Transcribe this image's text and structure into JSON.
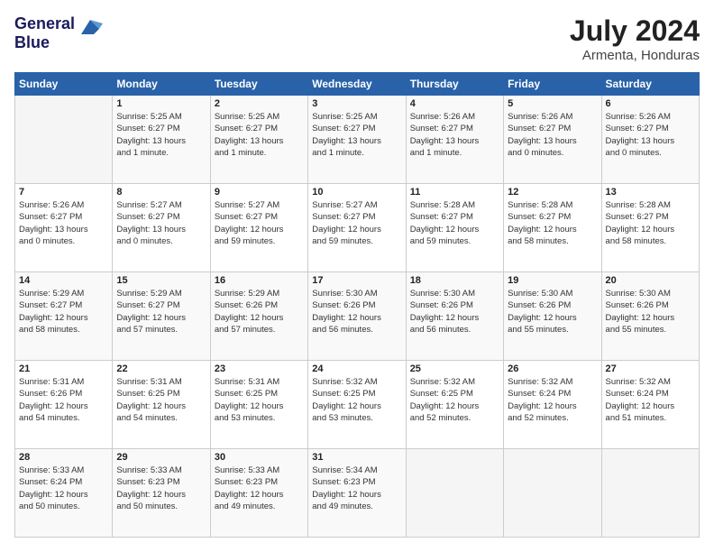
{
  "header": {
    "logo_line1": "General",
    "logo_line2": "Blue",
    "month_year": "July 2024",
    "location": "Armenta, Honduras"
  },
  "weekdays": [
    "Sunday",
    "Monday",
    "Tuesday",
    "Wednesday",
    "Thursday",
    "Friday",
    "Saturday"
  ],
  "weeks": [
    [
      {
        "day": "",
        "details": ""
      },
      {
        "day": "1",
        "details": "Sunrise: 5:25 AM\nSunset: 6:27 PM\nDaylight: 13 hours\nand 1 minute."
      },
      {
        "day": "2",
        "details": "Sunrise: 5:25 AM\nSunset: 6:27 PM\nDaylight: 13 hours\nand 1 minute."
      },
      {
        "day": "3",
        "details": "Sunrise: 5:25 AM\nSunset: 6:27 PM\nDaylight: 13 hours\nand 1 minute."
      },
      {
        "day": "4",
        "details": "Sunrise: 5:26 AM\nSunset: 6:27 PM\nDaylight: 13 hours\nand 1 minute."
      },
      {
        "day": "5",
        "details": "Sunrise: 5:26 AM\nSunset: 6:27 PM\nDaylight: 13 hours\nand 0 minutes."
      },
      {
        "day": "6",
        "details": "Sunrise: 5:26 AM\nSunset: 6:27 PM\nDaylight: 13 hours\nand 0 minutes."
      }
    ],
    [
      {
        "day": "7",
        "details": "Sunrise: 5:26 AM\nSunset: 6:27 PM\nDaylight: 13 hours\nand 0 minutes."
      },
      {
        "day": "8",
        "details": "Sunrise: 5:27 AM\nSunset: 6:27 PM\nDaylight: 13 hours\nand 0 minutes."
      },
      {
        "day": "9",
        "details": "Sunrise: 5:27 AM\nSunset: 6:27 PM\nDaylight: 12 hours\nand 59 minutes."
      },
      {
        "day": "10",
        "details": "Sunrise: 5:27 AM\nSunset: 6:27 PM\nDaylight: 12 hours\nand 59 minutes."
      },
      {
        "day": "11",
        "details": "Sunrise: 5:28 AM\nSunset: 6:27 PM\nDaylight: 12 hours\nand 59 minutes."
      },
      {
        "day": "12",
        "details": "Sunrise: 5:28 AM\nSunset: 6:27 PM\nDaylight: 12 hours\nand 58 minutes."
      },
      {
        "day": "13",
        "details": "Sunrise: 5:28 AM\nSunset: 6:27 PM\nDaylight: 12 hours\nand 58 minutes."
      }
    ],
    [
      {
        "day": "14",
        "details": "Sunrise: 5:29 AM\nSunset: 6:27 PM\nDaylight: 12 hours\nand 58 minutes."
      },
      {
        "day": "15",
        "details": "Sunrise: 5:29 AM\nSunset: 6:27 PM\nDaylight: 12 hours\nand 57 minutes."
      },
      {
        "day": "16",
        "details": "Sunrise: 5:29 AM\nSunset: 6:26 PM\nDaylight: 12 hours\nand 57 minutes."
      },
      {
        "day": "17",
        "details": "Sunrise: 5:30 AM\nSunset: 6:26 PM\nDaylight: 12 hours\nand 56 minutes."
      },
      {
        "day": "18",
        "details": "Sunrise: 5:30 AM\nSunset: 6:26 PM\nDaylight: 12 hours\nand 56 minutes."
      },
      {
        "day": "19",
        "details": "Sunrise: 5:30 AM\nSunset: 6:26 PM\nDaylight: 12 hours\nand 55 minutes."
      },
      {
        "day": "20",
        "details": "Sunrise: 5:30 AM\nSunset: 6:26 PM\nDaylight: 12 hours\nand 55 minutes."
      }
    ],
    [
      {
        "day": "21",
        "details": "Sunrise: 5:31 AM\nSunset: 6:26 PM\nDaylight: 12 hours\nand 54 minutes."
      },
      {
        "day": "22",
        "details": "Sunrise: 5:31 AM\nSunset: 6:25 PM\nDaylight: 12 hours\nand 54 minutes."
      },
      {
        "day": "23",
        "details": "Sunrise: 5:31 AM\nSunset: 6:25 PM\nDaylight: 12 hours\nand 53 minutes."
      },
      {
        "day": "24",
        "details": "Sunrise: 5:32 AM\nSunset: 6:25 PM\nDaylight: 12 hours\nand 53 minutes."
      },
      {
        "day": "25",
        "details": "Sunrise: 5:32 AM\nSunset: 6:25 PM\nDaylight: 12 hours\nand 52 minutes."
      },
      {
        "day": "26",
        "details": "Sunrise: 5:32 AM\nSunset: 6:24 PM\nDaylight: 12 hours\nand 52 minutes."
      },
      {
        "day": "27",
        "details": "Sunrise: 5:32 AM\nSunset: 6:24 PM\nDaylight: 12 hours\nand 51 minutes."
      }
    ],
    [
      {
        "day": "28",
        "details": "Sunrise: 5:33 AM\nSunset: 6:24 PM\nDaylight: 12 hours\nand 50 minutes."
      },
      {
        "day": "29",
        "details": "Sunrise: 5:33 AM\nSunset: 6:23 PM\nDaylight: 12 hours\nand 50 minutes."
      },
      {
        "day": "30",
        "details": "Sunrise: 5:33 AM\nSunset: 6:23 PM\nDaylight: 12 hours\nand 49 minutes."
      },
      {
        "day": "31",
        "details": "Sunrise: 5:34 AM\nSunset: 6:23 PM\nDaylight: 12 hours\nand 49 minutes."
      },
      {
        "day": "",
        "details": ""
      },
      {
        "day": "",
        "details": ""
      },
      {
        "day": "",
        "details": ""
      }
    ]
  ]
}
